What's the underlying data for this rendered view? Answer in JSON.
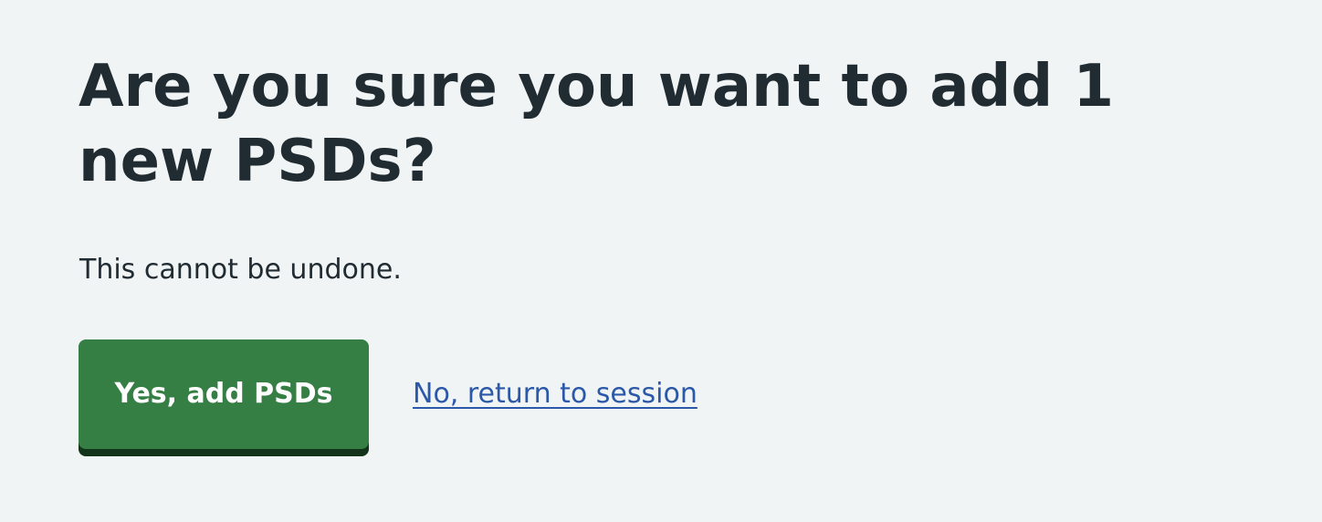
{
  "page": {
    "title": "Are you sure you want to add 1 new PSDs?",
    "subtitle": "This cannot be undone."
  },
  "actions": {
    "confirm_label": "Yes, add PSDs",
    "cancel_label": "No, return to session"
  },
  "colors": {
    "background": "#f0f4f5",
    "text": "#212b32",
    "primary_button": "#357e44",
    "primary_button_shadow": "#13331a",
    "link": "#2b58a8"
  }
}
